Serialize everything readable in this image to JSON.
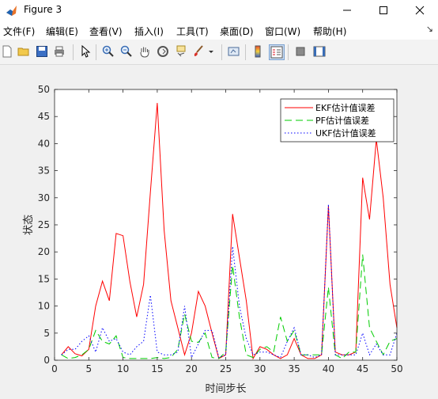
{
  "window": {
    "title": "Figure 3"
  },
  "menu": {
    "items": [
      "文件(F)",
      "编辑(E)",
      "查看(V)",
      "插入(I)",
      "工具(T)",
      "桌面(D)",
      "窗口(W)",
      "帮助(H)"
    ]
  },
  "toolbar": {
    "icons": [
      "new-figure-icon",
      "open-icon",
      "save-icon",
      "print-icon",
      "pointer-icon",
      "zoom-in-icon",
      "zoom-out-icon",
      "pan-icon",
      "rotate-icon",
      "data-cursor-icon",
      "brush-icon",
      "link-icon",
      "colorbar-icon",
      "legend-icon",
      "hide-plot-tools-icon",
      "show-plot-tools-icon"
    ]
  },
  "colors": {
    "ekf": "#ff0000",
    "pf": "#00cc00",
    "ukf": "#0000ff"
  },
  "chart_data": {
    "type": "line",
    "title": "",
    "xlabel": "时间步长",
    "ylabel": "状态",
    "xlim": [
      0,
      50
    ],
    "ylim": [
      0,
      50
    ],
    "xticks": [
      0,
      5,
      10,
      15,
      20,
      25,
      30,
      35,
      40,
      45,
      50
    ],
    "yticks": [
      0,
      5,
      10,
      15,
      20,
      25,
      30,
      35,
      40,
      45,
      50
    ],
    "grid": false,
    "legend": "top-right",
    "x": [
      1,
      2,
      3,
      4,
      5,
      6,
      7,
      8,
      9,
      10,
      11,
      12,
      13,
      14,
      15,
      16,
      17,
      18,
      19,
      20,
      21,
      22,
      23,
      24,
      25,
      26,
      27,
      28,
      29,
      30,
      31,
      32,
      33,
      34,
      35,
      36,
      37,
      38,
      39,
      40,
      41,
      42,
      43,
      44,
      45,
      46,
      47,
      48,
      49,
      50
    ],
    "series": [
      {
        "name": "EKF估计值误差",
        "style": "solid",
        "values": [
          1.0,
          2.5,
          1.2,
          0.8,
          2.0,
          10.0,
          14.6,
          11.0,
          23.4,
          23.0,
          14.5,
          8.0,
          14.0,
          31.0,
          47.5,
          24.0,
          11.0,
          6.0,
          1.0,
          5.0,
          12.7,
          10.0,
          5.0,
          0.3,
          1.0,
          27.0,
          19.0,
          11.0,
          0.3,
          2.5,
          2.0,
          1.0,
          0.3,
          1.0,
          4.0,
          1.0,
          0.3,
          0.3,
          1.0,
          28.5,
          1.5,
          1.0,
          1.0,
          1.5,
          33.7,
          26.0,
          40.8,
          30.0,
          14.0,
          6.0
        ]
      },
      {
        "name": "PF估计值误差",
        "style": "dashed",
        "values": [
          1.0,
          0.3,
          0.5,
          1.0,
          2.0,
          5.5,
          3.5,
          3.0,
          4.5,
          0.5,
          0.3,
          0.3,
          0.3,
          0.3,
          0.5,
          0.3,
          0.5,
          2.0,
          8.5,
          3.5,
          3.3,
          5.0,
          0.5,
          0.3,
          1.5,
          17.5,
          8.0,
          1.0,
          0.5,
          2.0,
          2.5,
          1.5,
          8.0,
          3.5,
          5.5,
          1.0,
          1.0,
          1.0,
          1.0,
          13.5,
          1.0,
          0.3,
          1.5,
          1.5,
          19.5,
          6.0,
          3.5,
          1.0,
          3.5,
          4.0
        ]
      },
      {
        "name": "UKF估计值误差",
        "style": "dotted",
        "values": [
          1.0,
          2.0,
          2.0,
          3.5,
          4.5,
          1.5,
          6.0,
          3.5,
          4.0,
          1.5,
          1.0,
          2.5,
          3.5,
          12.0,
          1.5,
          1.0,
          1.0,
          1.5,
          10.0,
          0.5,
          3.0,
          5.5,
          5.5,
          0.5,
          1.0,
          21.0,
          10.0,
          4.0,
          1.0,
          1.5,
          1.5,
          1.0,
          0.5,
          3.5,
          6.0,
          1.0,
          1.0,
          0.5,
          1.0,
          28.8,
          1.0,
          1.0,
          1.0,
          1.0,
          5.0,
          1.0,
          3.0,
          1.0,
          1.0,
          5.0
        ]
      }
    ]
  }
}
